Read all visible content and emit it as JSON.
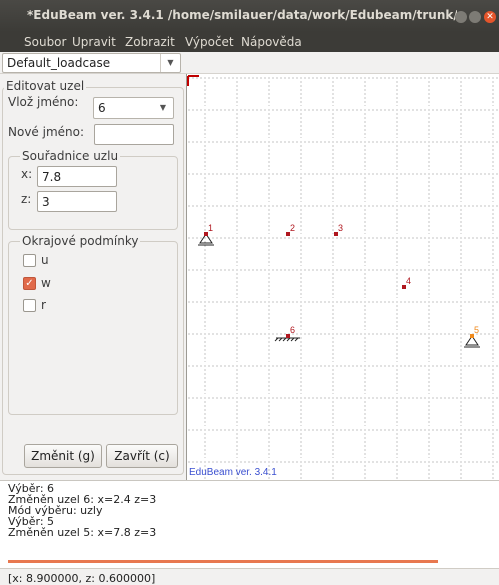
{
  "window": {
    "title": "*EduBeam ver. 3.4.1 /home/smilauer/data/work/Edubeam/trunk/userGuide"
  },
  "menu": [
    "Soubor",
    "Upravit",
    "Zobrazit",
    "Výpočet",
    "Nápověda"
  ],
  "toolbar": {
    "loadcase": "Default_loadcase"
  },
  "panel": {
    "title": "Editovat uzel",
    "insert_name_label": "Vlož jméno:",
    "insert_name_value": "6",
    "new_name_label": "Nové jméno:",
    "new_name_value": "",
    "coords_title": "Souřadnice uzlu",
    "x_label": "x:",
    "x_value": "7.8",
    "z_label": "z:",
    "z_value": "3",
    "bc_title": "Okrajové podmínky",
    "bc": [
      {
        "label": "u",
        "checked": false
      },
      {
        "label": "w",
        "checked": true
      },
      {
        "label": "r",
        "checked": false
      }
    ],
    "change_button": "Změnit (g)",
    "close_button": "Zavřít (c)"
  },
  "canvas": {
    "watermark": "EduBeam ver. 3.4.1",
    "nodes": [
      {
        "label": "1"
      },
      {
        "label": "2"
      },
      {
        "label": "3"
      },
      {
        "label": "4"
      },
      {
        "label": "6"
      },
      {
        "label": "5"
      }
    ]
  },
  "log": [
    "Výběr: 6",
    "Změněn uzel 6: x=2.4 z=3",
    "Mód výběru: uzly",
    "Výběr: 5",
    "Změněn uzel 5: x=7.8 z=3"
  ],
  "status": "[x: 8.900000, z: 0.600000]",
  "colors": {
    "accent": "#e16a4a",
    "node": "#b0171f",
    "selected_node": "#f08a1c"
  }
}
